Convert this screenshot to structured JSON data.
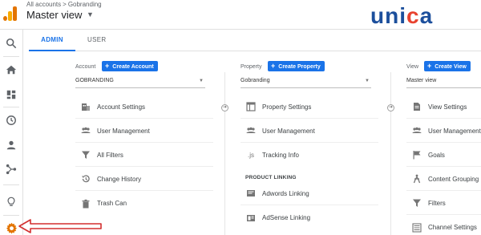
{
  "header": {
    "breadcrumb_all": "All accounts",
    "breadcrumb_sep": ">",
    "breadcrumb_account": "Gobranding",
    "view_title": "Master view",
    "brand_left": "uni",
    "brand_c": "c",
    "brand_right": "a"
  },
  "tabs": [
    {
      "label": "ADMIN",
      "active": true
    },
    {
      "label": "USER",
      "active": false
    }
  ],
  "account": {
    "label": "Account",
    "create_label": "Create Account",
    "selected": "GOBRANDING",
    "items": [
      {
        "label": "Account Settings",
        "icon": "building-icon"
      },
      {
        "label": "User Management",
        "icon": "users-icon"
      },
      {
        "label": "All Filters",
        "icon": "filter-icon"
      },
      {
        "label": "Change History",
        "icon": "history-icon"
      },
      {
        "label": "Trash Can",
        "icon": "trash-icon"
      }
    ]
  },
  "property": {
    "label": "Property",
    "create_label": "Create Property",
    "selected": "Gobranding",
    "items": [
      {
        "label": "Property Settings",
        "icon": "window-icon"
      },
      {
        "label": "User Management",
        "icon": "users-icon"
      },
      {
        "label": "Tracking Info",
        "icon": "js-icon",
        "icon_text": ".js"
      }
    ],
    "section_label": "PRODUCT LINKING",
    "linking_items": [
      {
        "label": "Adwords Linking",
        "icon": "adwords-icon"
      },
      {
        "label": "AdSense Linking",
        "icon": "adsense-icon"
      }
    ]
  },
  "view": {
    "label": "View",
    "create_label": "Create View",
    "selected": "Master view",
    "items": [
      {
        "label": "View Settings",
        "icon": "document-icon"
      },
      {
        "label": "User Management",
        "icon": "users-icon"
      },
      {
        "label": "Goals",
        "icon": "flag-icon"
      },
      {
        "label": "Content Grouping",
        "icon": "person-walk-icon"
      },
      {
        "label": "Filters",
        "icon": "filter-icon"
      },
      {
        "label": "Channel Settings",
        "icon": "channel-icon"
      }
    ]
  },
  "colors": {
    "accent": "#1a73e8",
    "annotation_arrow": "#d32f2f",
    "gear_active": "#e37400",
    "brand_blue": "#1c4f9c",
    "brand_orange": "#e8422f"
  }
}
